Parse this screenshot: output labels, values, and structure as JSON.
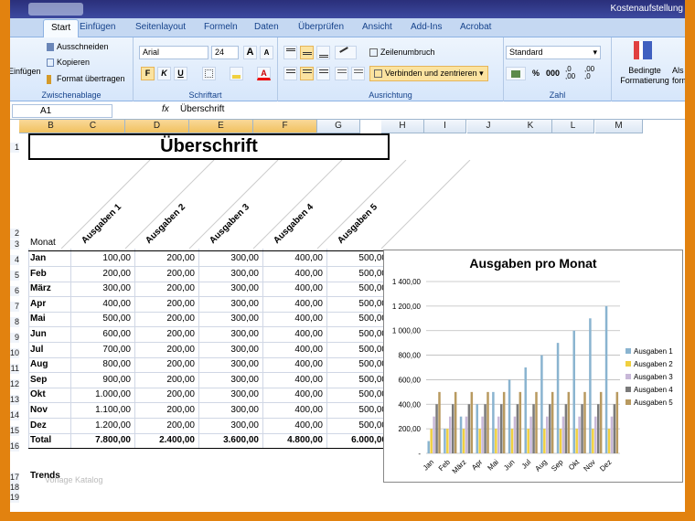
{
  "window": {
    "title": "Kostenaufstellung"
  },
  "tabs": [
    "Start",
    "Einfügen",
    "Seitenlayout",
    "Formeln",
    "Daten",
    "Überprüfen",
    "Ansicht",
    "Add-Ins",
    "Acrobat"
  ],
  "clipboard": {
    "paste": "Einfügen",
    "cut": "Ausschneiden",
    "copy": "Kopieren",
    "format": "Format übertragen",
    "label": "Zwischenablage"
  },
  "font": {
    "name": "Arial",
    "size": "24",
    "bold": "F",
    "italic": "K",
    "underline": "U",
    "grow": "A",
    "shrink": "A",
    "color": "A",
    "label": "Schriftart"
  },
  "alignment": {
    "wrap": "Zeilenumbruch",
    "merge": "Verbinden und zentrieren",
    "label": "Ausrichtung"
  },
  "number": {
    "format": "Standard",
    "percent": "%",
    "thousands": "000",
    "inc": ",0 ,00",
    "dec": ",00 ,0",
    "label": "Zahl"
  },
  "styles": {
    "cond": "Bedingte Formatierung",
    "table": "Als format"
  },
  "formula_bar": {
    "cell_ref": "A1",
    "fx": "fx",
    "content": "Überschrift"
  },
  "columns": [
    "A",
    "B",
    "C",
    "D",
    "E",
    "F",
    "G",
    "H",
    "I",
    "J",
    "K",
    "L",
    "M"
  ],
  "rows": [
    "1",
    "2",
    "3",
    "4",
    "5",
    "6",
    "7",
    "8",
    "9",
    "10",
    "11",
    "12",
    "13",
    "14",
    "15",
    "16",
    "17",
    "18",
    "19"
  ],
  "sheet": {
    "title": "Überschrift",
    "month_header": "Monat",
    "col_headers": [
      "Ausgaben 1",
      "Ausgaben 2",
      "Ausgaben 3",
      "Ausgaben 4",
      "Ausgaben 5"
    ],
    "months": [
      "Jan",
      "Feb",
      "März",
      "Apr",
      "Mai",
      "Jun",
      "Jul",
      "Aug",
      "Sep",
      "Okt",
      "Nov",
      "Dez"
    ],
    "values": [
      [
        "100,00",
        "200,00",
        "300,00",
        "400,00",
        "500,00"
      ],
      [
        "200,00",
        "200,00",
        "300,00",
        "400,00",
        "500,00"
      ],
      [
        "300,00",
        "200,00",
        "300,00",
        "400,00",
        "500,00"
      ],
      [
        "400,00",
        "200,00",
        "300,00",
        "400,00",
        "500,00"
      ],
      [
        "500,00",
        "200,00",
        "300,00",
        "400,00",
        "500,00"
      ],
      [
        "600,00",
        "200,00",
        "300,00",
        "400,00",
        "500,00"
      ],
      [
        "700,00",
        "200,00",
        "300,00",
        "400,00",
        "500,00"
      ],
      [
        "800,00",
        "200,00",
        "300,00",
        "400,00",
        "500,00"
      ],
      [
        "900,00",
        "200,00",
        "300,00",
        "400,00",
        "500,00"
      ],
      [
        "1.000,00",
        "200,00",
        "300,00",
        "400,00",
        "500,00"
      ],
      [
        "1.100,00",
        "200,00",
        "300,00",
        "400,00",
        "500,00"
      ],
      [
        "1.200,00",
        "200,00",
        "300,00",
        "400,00",
        "500,00"
      ]
    ],
    "total_label": "Total",
    "totals": [
      "7.800,00",
      "2.400,00",
      "3.600,00",
      "4.800,00",
      "6.000,00"
    ],
    "trends_label": "Trends",
    "watermark": "Vorlage Katalog"
  },
  "chart_data": {
    "type": "bar",
    "title": "Ausgaben pro Monat",
    "categories": [
      "Jan",
      "Feb",
      "März",
      "Apr",
      "Mai",
      "Jun",
      "Jul",
      "Aug",
      "Sep",
      "Okt",
      "Nov",
      "Dez"
    ],
    "series": [
      {
        "name": "Ausgaben 1",
        "values": [
          100,
          200,
          300,
          400,
          500,
          600,
          700,
          800,
          900,
          1000,
          1100,
          1200
        ],
        "color": "#8ab4d0"
      },
      {
        "name": "Ausgaben 2",
        "values": [
          200,
          200,
          200,
          200,
          200,
          200,
          200,
          200,
          200,
          200,
          200,
          200
        ],
        "color": "#f0d040"
      },
      {
        "name": "Ausgaben 3",
        "values": [
          300,
          300,
          300,
          300,
          300,
          300,
          300,
          300,
          300,
          300,
          300,
          300
        ],
        "color": "#c8b8d8"
      },
      {
        "name": "Ausgaben 4",
        "values": [
          400,
          400,
          400,
          400,
          400,
          400,
          400,
          400,
          400,
          400,
          400,
          400
        ],
        "color": "#7a7a7a"
      },
      {
        "name": "Ausgaben 5",
        "values": [
          500,
          500,
          500,
          500,
          500,
          500,
          500,
          500,
          500,
          500,
          500,
          500
        ],
        "color": "#b89a60"
      }
    ],
    "yticks": [
      "-",
      "200,00",
      "400,00",
      "600,00",
      "800,00",
      "1 000,00",
      "1 200,00",
      "1 400,00"
    ],
    "ylim": [
      0,
      1400
    ],
    "grid": true,
    "legend": "right"
  }
}
